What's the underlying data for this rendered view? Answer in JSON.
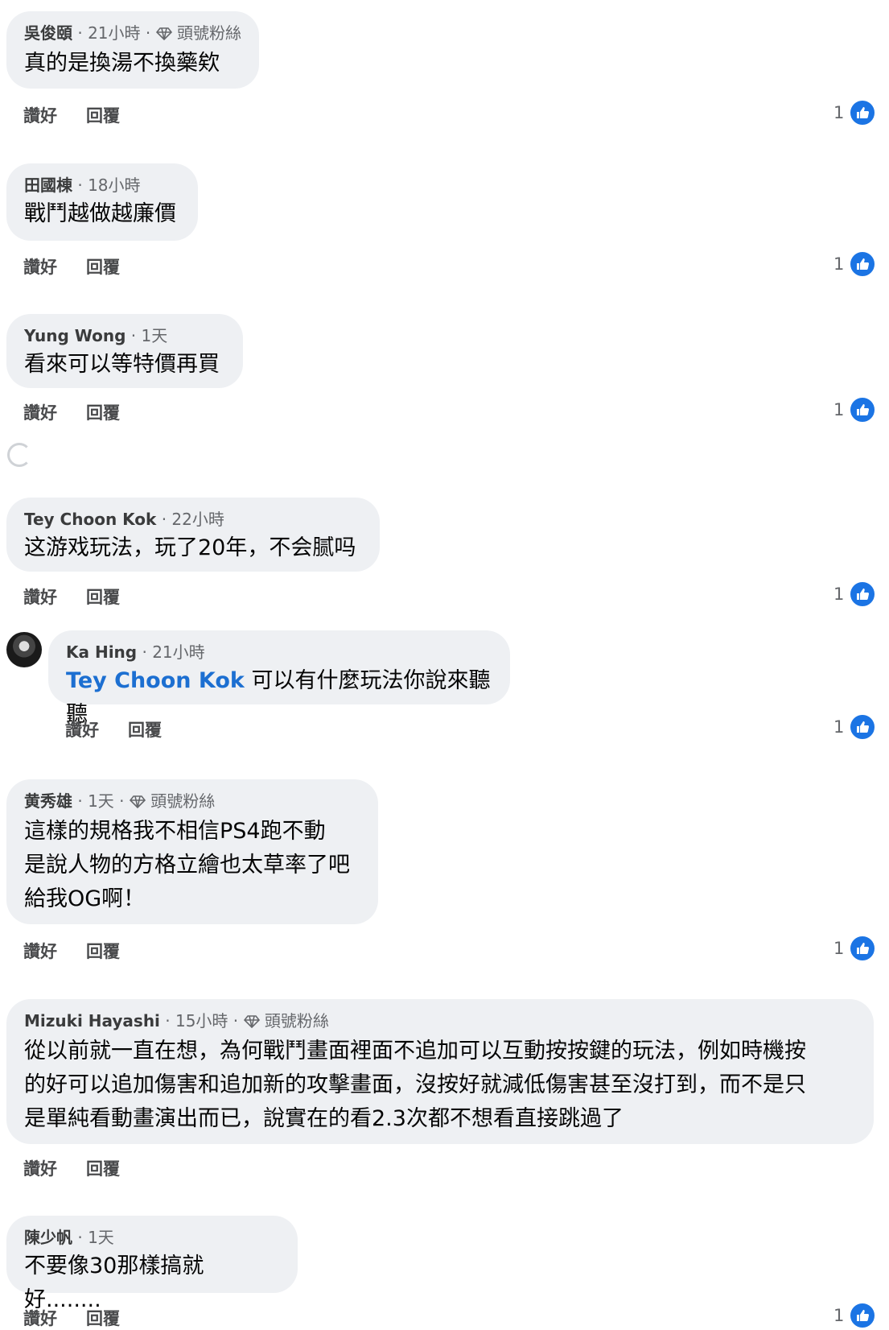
{
  "labels": {
    "like": "讚好",
    "reply": "回覆"
  },
  "colors": {
    "like_blue": "#1b74e4",
    "mention_blue": "#1c6fd1",
    "bubble": "#eef0f3"
  },
  "comments": [
    {
      "name": "吳俊頤",
      "time": "21小時",
      "badge": "頭號粉絲",
      "lines": [
        "真的是換湯不換藥欸"
      ],
      "likes": "1"
    },
    {
      "name": "田國棟",
      "time": "18小時",
      "lines": [
        "戰鬥越做越廉價"
      ],
      "likes": "1"
    },
    {
      "name": "Yung Wong",
      "time": "1天",
      "lines": [
        "看來可以等特價再買"
      ],
      "likes": "1"
    },
    {
      "name": "Tey Choon Kok",
      "time": "22小時",
      "lines": [
        "这游戏玩法，玩了20年，不会腻吗"
      ],
      "likes": "1"
    },
    {
      "name": "Ka Hing",
      "time": "21小時",
      "mention": "Tey Choon Kok",
      "lines": [
        "可以有什麼玩法你說來聽聽"
      ],
      "likes": "1"
    },
    {
      "name": "黄秀雄",
      "time": "1天",
      "badge": "頭號粉絲",
      "lines": [
        "這樣的規格我不相信PS4跑不動",
        "是說人物的方格立繪也太草率了吧",
        "給我OG啊！"
      ],
      "likes": "1"
    },
    {
      "name": "Mizuki Hayashi",
      "time": "15小時",
      "badge": "頭號粉絲",
      "lines": [
        "從以前就一直在想，為何戰鬥畫面裡面不追加可以互動按按鍵的玩法，例如時機按",
        "的好可以追加傷害和追加新的攻擊畫面，沒按好就減低傷害甚至沒打到，而不是只",
        "是單純看動畫演出而已，說實在的看2.3次都不想看直接跳過了"
      ]
    },
    {
      "name": "陳少帆",
      "time": "1天",
      "lines": [
        "不要像30那樣搞就好........"
      ],
      "likes": "1"
    }
  ]
}
